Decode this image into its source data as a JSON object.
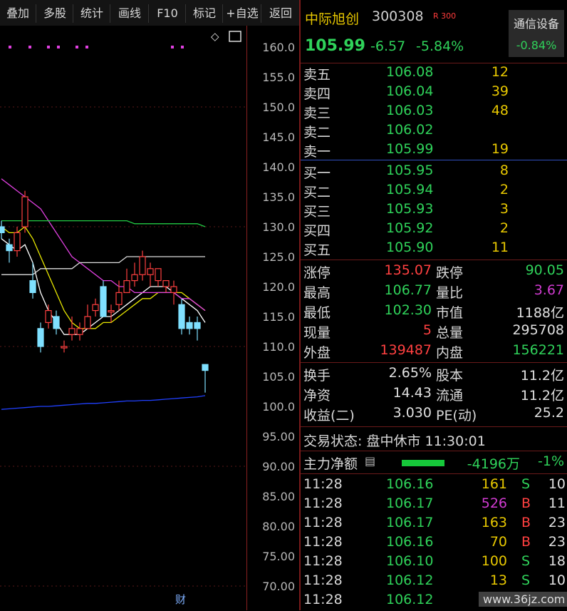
{
  "toolbar": [
    "叠加",
    "多股",
    "统计",
    "画线",
    "F10",
    "标记",
    "+自选",
    "返回"
  ],
  "chart_icons": {
    "diamond": "diamond-icon",
    "panel": "panel-toggle-icon"
  },
  "axis_labels": [
    "160.0",
    "155.0",
    "150.0",
    "145.0",
    "140.0",
    "135.0",
    "130.0",
    "125.0",
    "120.0",
    "115.0",
    "110.0",
    "105.0",
    "100.0",
    "95.00",
    "90.00",
    "85.00",
    "80.00",
    "75.00",
    "70.00"
  ],
  "fin_marker": "财",
  "quote": {
    "name": "中际旭创",
    "code": "300308",
    "badge": "R 300",
    "price": "105.99",
    "change": "-6.57",
    "change_pct": "-5.84%",
    "sector_name": "通信设备",
    "sector_change": "-0.84%"
  },
  "sell": [
    {
      "label": "卖五",
      "price": "106.08",
      "vol": "12"
    },
    {
      "label": "卖四",
      "price": "106.04",
      "vol": "39"
    },
    {
      "label": "卖三",
      "price": "106.03",
      "vol": "48"
    },
    {
      "label": "卖二",
      "price": "106.02",
      "vol": ""
    },
    {
      "label": "卖一",
      "price": "105.99",
      "vol": "19"
    }
  ],
  "buy": [
    {
      "label": "买一",
      "price": "105.95",
      "vol": "8"
    },
    {
      "label": "买二",
      "price": "105.94",
      "vol": "2"
    },
    {
      "label": "买三",
      "price": "105.93",
      "vol": "3"
    },
    {
      "label": "买四",
      "price": "105.92",
      "vol": "2"
    },
    {
      "label": "买五",
      "price": "105.90",
      "vol": "11"
    }
  ],
  "stats1": [
    {
      "l1": "涨停",
      "v1": "135.07",
      "c1": "red",
      "l2": "跌停",
      "v2": "90.05",
      "c2": "green"
    },
    {
      "l1": "最高",
      "v1": "106.77",
      "c1": "green",
      "l2": "量比",
      "v2": "3.67",
      "c2": "purple"
    },
    {
      "l1": "最低",
      "v1": "102.30",
      "c1": "green",
      "l2": "市值",
      "v2": "1188亿",
      "c2": "white"
    },
    {
      "l1": "现量",
      "v1": "5",
      "c1": "red",
      "l2": "总量",
      "v2": "295708",
      "c2": "white"
    },
    {
      "l1": "外盘",
      "v1": "139487",
      "c1": "red",
      "l2": "内盘",
      "v2": "156221",
      "c2": "green"
    }
  ],
  "stats2": [
    {
      "l1": "换手",
      "v1": "2.65%",
      "l2": "股本",
      "v2": "11.2亿"
    },
    {
      "l1": "净资",
      "v1": "14.43",
      "l2": "流通",
      "v2": "11.2亿"
    },
    {
      "l1": "收益(二)",
      "v1": "3.030",
      "l2": "PE(动)",
      "v2": "25.2"
    }
  ],
  "trade_status": "交易状态: 盘中休市 11:30:01",
  "main_flow": {
    "label": "主力净额",
    "amount": "-4196万",
    "pct": "-1%"
  },
  "ticks": [
    {
      "time": "11:28",
      "price": "106.16",
      "vol": "161",
      "vc": "yellow",
      "side": "S",
      "sc": "green",
      "n": "10"
    },
    {
      "time": "11:28",
      "price": "106.17",
      "vol": "526",
      "vc": "purple",
      "side": "B",
      "sc": "red",
      "n": "11"
    },
    {
      "time": "11:28",
      "price": "106.17",
      "vol": "163",
      "vc": "yellow",
      "side": "B",
      "sc": "red",
      "n": "23"
    },
    {
      "time": "11:28",
      "price": "106.16",
      "vol": "70",
      "vc": "yellow",
      "side": "B",
      "sc": "red",
      "n": "23"
    },
    {
      "time": "11:28",
      "price": "106.10",
      "vol": "100",
      "vc": "yellow",
      "side": "S",
      "sc": "green",
      "n": "18"
    },
    {
      "time": "11:28",
      "price": "106.12",
      "vol": "13",
      "vc": "yellow",
      "side": "S",
      "sc": "green",
      "n": "10"
    },
    {
      "time": "11:28",
      "price": "106.12",
      "vol": "",
      "vc": "yellow",
      "side": "",
      "sc": "green",
      "n": ""
    }
  ],
  "watermark": "www.36jz.com",
  "colors": {
    "up": "#ff4040",
    "down": "#2fd25a",
    "flat": "#7fe0ff"
  },
  "chart_data": {
    "type": "candlestick",
    "ylim": [
      70,
      160
    ],
    "candles": [
      {
        "o": 130,
        "h": 131,
        "l": 128,
        "c": 129
      },
      {
        "o": 127,
        "h": 128,
        "l": 124,
        "c": 126
      },
      {
        "o": 126,
        "h": 130,
        "l": 125,
        "c": 129
      },
      {
        "o": 130,
        "h": 136,
        "l": 129,
        "c": 135
      },
      {
        "o": 121,
        "h": 124,
        "l": 118,
        "c": 119
      },
      {
        "o": 113,
        "h": 114,
        "l": 109,
        "c": 110
      },
      {
        "o": 114,
        "h": 117,
        "l": 113,
        "c": 116
      },
      {
        "o": 115,
        "h": 116,
        "l": 112,
        "c": 113
      },
      {
        "o": 110,
        "h": 111,
        "l": 109,
        "c": 110
      },
      {
        "o": 112,
        "h": 115,
        "l": 111,
        "c": 113
      },
      {
        "o": 112,
        "h": 114,
        "l": 111,
        "c": 113
      },
      {
        "o": 113,
        "h": 117,
        "l": 113,
        "c": 115
      },
      {
        "o": 116,
        "h": 118,
        "l": 115,
        "c": 117
      },
      {
        "o": 120,
        "h": 121,
        "l": 115,
        "c": 115
      },
      {
        "o": 116,
        "h": 117,
        "l": 114,
        "c": 116
      },
      {
        "o": 117,
        "h": 121,
        "l": 116,
        "c": 119
      },
      {
        "o": 119,
        "h": 123,
        "l": 119,
        "c": 121
      },
      {
        "o": 121,
        "h": 124,
        "l": 120,
        "c": 122
      },
      {
        "o": 122,
        "h": 126,
        "l": 121,
        "c": 125
      },
      {
        "o": 122,
        "h": 124,
        "l": 120,
        "c": 123
      },
      {
        "o": 121,
        "h": 123,
        "l": 120,
        "c": 123
      },
      {
        "o": 120,
        "h": 121,
        "l": 119,
        "c": 121
      },
      {
        "o": 119,
        "h": 121,
        "l": 117,
        "c": 120
      },
      {
        "o": 117,
        "h": 118,
        "l": 112,
        "c": 113
      },
      {
        "o": 114,
        "h": 115,
        "l": 112,
        "c": 113
      },
      {
        "o": 114,
        "h": 115,
        "l": 111,
        "c": 113
      },
      {
        "o": 107,
        "h": 107,
        "l": 102.3,
        "c": 106
      }
    ],
    "ma": [
      {
        "color": "#ffffff",
        "values": [
          128,
          127,
          126,
          127,
          124,
          119,
          116,
          114,
          112,
          112,
          112,
          113,
          114,
          115,
          115,
          116,
          117,
          118,
          119,
          120,
          120,
          120,
          119,
          118,
          117,
          116,
          114
        ]
      },
      {
        "color": "#e8e800",
        "values": [
          130,
          129,
          129,
          130,
          128,
          125,
          122,
          119,
          116,
          114,
          113,
          113,
          113,
          114,
          114,
          115,
          116,
          117,
          118,
          118,
          119,
          119,
          119,
          119,
          118,
          117,
          116
        ]
      },
      {
        "color": "#e040e0",
        "values": [
          138,
          137,
          136,
          135,
          134,
          133,
          131,
          129,
          127,
          125,
          124,
          123,
          122,
          121,
          121,
          120,
          120,
          119,
          119,
          119,
          119,
          119,
          119,
          118,
          118,
          117,
          116
        ]
      },
      {
        "color": "#22cc44",
        "values": [
          131,
          131,
          131,
          131,
          131,
          131,
          131,
          131,
          131,
          131,
          131,
          131,
          131,
          131,
          131,
          131,
          131,
          130.5,
          130.5,
          130.5,
          130.5,
          130.5,
          130.5,
          130.5,
          130.5,
          130.5,
          130
        ]
      },
      {
        "color": "#dddddd",
        "values": [
          122,
          122,
          122,
          122,
          122,
          123,
          123,
          123,
          123,
          123,
          124,
          124,
          124,
          124,
          124,
          124,
          125,
          125,
          125,
          125,
          125,
          125,
          125,
          125,
          125,
          125,
          125
        ]
      },
      {
        "color": "#2040ff",
        "values": [
          99.5,
          99.6,
          99.7,
          99.8,
          99.9,
          100,
          100,
          100.1,
          100.2,
          100.3,
          100.4,
          100.5,
          100.5,
          100.6,
          100.7,
          100.8,
          100.9,
          100.9,
          101,
          101,
          101.1,
          101.2,
          101.3,
          101.4,
          101.5,
          101.6,
          101.8
        ]
      }
    ],
    "magenta_dots": 6
  }
}
